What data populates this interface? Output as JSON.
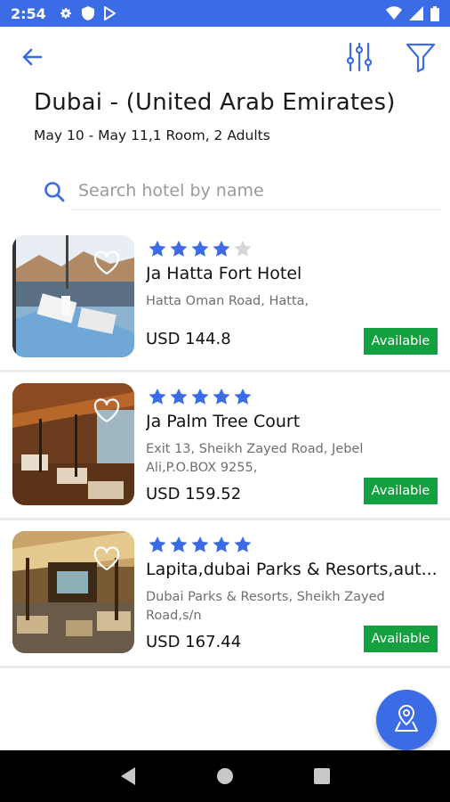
{
  "status_bar": {
    "time": "2:54",
    "icons_left": [
      "gear-icon",
      "shield-icon",
      "play-store-icon"
    ],
    "icons_right": [
      "wifi-icon",
      "signal-icon",
      "battery-icon"
    ]
  },
  "toolbar": {
    "back_icon": "arrow-left-icon",
    "sliders_icon": "sliders-icon",
    "filter_icon": "funnel-icon"
  },
  "header": {
    "title": "Dubai - (United Arab Emirates)",
    "subtitle": "May 10 - May 11,1 Room, 2 Adults"
  },
  "search": {
    "placeholder": "Search hotel by name",
    "value": ""
  },
  "colors": {
    "accent": "#3b6ce6",
    "available": "#12a13e",
    "star_filled": "#3b6ce6",
    "star_empty": "#d6d6d6"
  },
  "hotels": [
    {
      "stars": 4,
      "name": "Ja Hatta Fort Hotel",
      "address": "Hatta Oman Road, Hatta,",
      "price": "USD 144.8",
      "status": "Available",
      "image": "hotel-pool-dining-photo"
    },
    {
      "stars": 5,
      "name": "Ja Palm Tree Court",
      "address": "Exit 13, Sheikh Zayed Road, Jebel Ali,P.O.BOX 9255,",
      "price": "USD 159.52",
      "status": "Available",
      "image": "hotel-restaurant-photo"
    },
    {
      "stars": 5,
      "name": "Lapita,dubai Parks & Resorts,aut...",
      "address": "Dubai Parks & Resorts, Sheikh Zayed Road,s/n",
      "price": "USD 167.44",
      "status": "Available",
      "image": "hotel-lobby-photo"
    }
  ],
  "fab": {
    "icon": "map-pin-icon"
  },
  "nav": {
    "icons": [
      "back-triangle-icon",
      "home-circle-icon",
      "recents-square-icon"
    ]
  }
}
